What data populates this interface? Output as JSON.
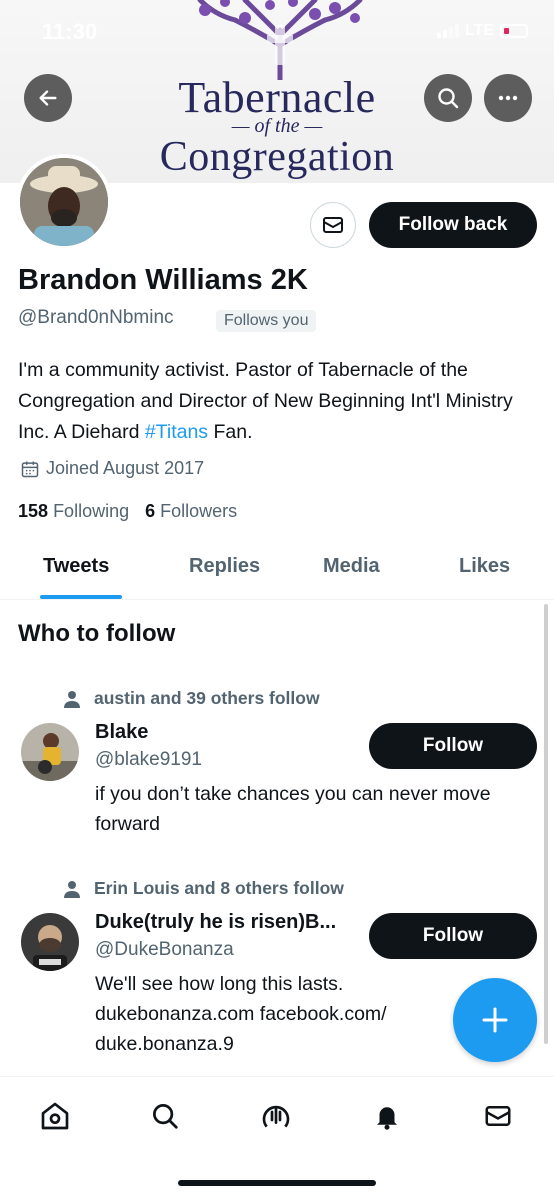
{
  "status_bar": {
    "time": "11:30",
    "network": "LTE"
  },
  "banner": {
    "line1": "Tabernacle",
    "line2": "— of the —",
    "line3": "Congregation"
  },
  "profile": {
    "name": "Brandon Williams 2K",
    "handle": "@Brand0nNbminc",
    "follows_you": "Follows you",
    "bio_pre": "I'm a community activist. Pastor of Tabernacle of the Congregation and Director of New Beginning Int'l Ministry Inc. A Diehard ",
    "bio_hashtag": "#Titans",
    "bio_post": " Fan.",
    "joined": "Joined August 2017",
    "following_count": "158",
    "following_label": "Following",
    "followers_count": "6",
    "followers_label": "Followers",
    "follow_back_label": "Follow back"
  },
  "tabs": [
    "Tweets",
    "Replies",
    "Media",
    "Likes"
  ],
  "who_to_follow": {
    "title": "Who to follow",
    "items": [
      {
        "social_context": "austin and 39 others follow",
        "name": "Blake",
        "handle": "@blake9191",
        "bio": "if you don’t take chances you can never move forward",
        "follow_label": "Follow"
      },
      {
        "social_context": "Erin Louis and 8 others follow",
        "name": "Duke(truly he is risen)B...",
        "handle": "@DukeBonanza",
        "bio": "We'll see how long this lasts. dukebonanza.com facebook.com/ duke.bonanza.9",
        "follow_label": "Follow"
      }
    ]
  },
  "colors": {
    "accent": "#1d9bf0",
    "text": "#0f1419",
    "secondary": "#536471",
    "banner_purple": "#27285b"
  },
  "icons": {
    "back": "arrow-left-icon",
    "search": "search-icon",
    "more": "more-icon",
    "message": "envelope-icon",
    "calendar": "calendar-icon",
    "person": "person-icon",
    "compose": "plus-icon",
    "nav": [
      "home-icon",
      "search-icon",
      "spaces-icon",
      "bell-icon",
      "envelope-icon"
    ]
  }
}
